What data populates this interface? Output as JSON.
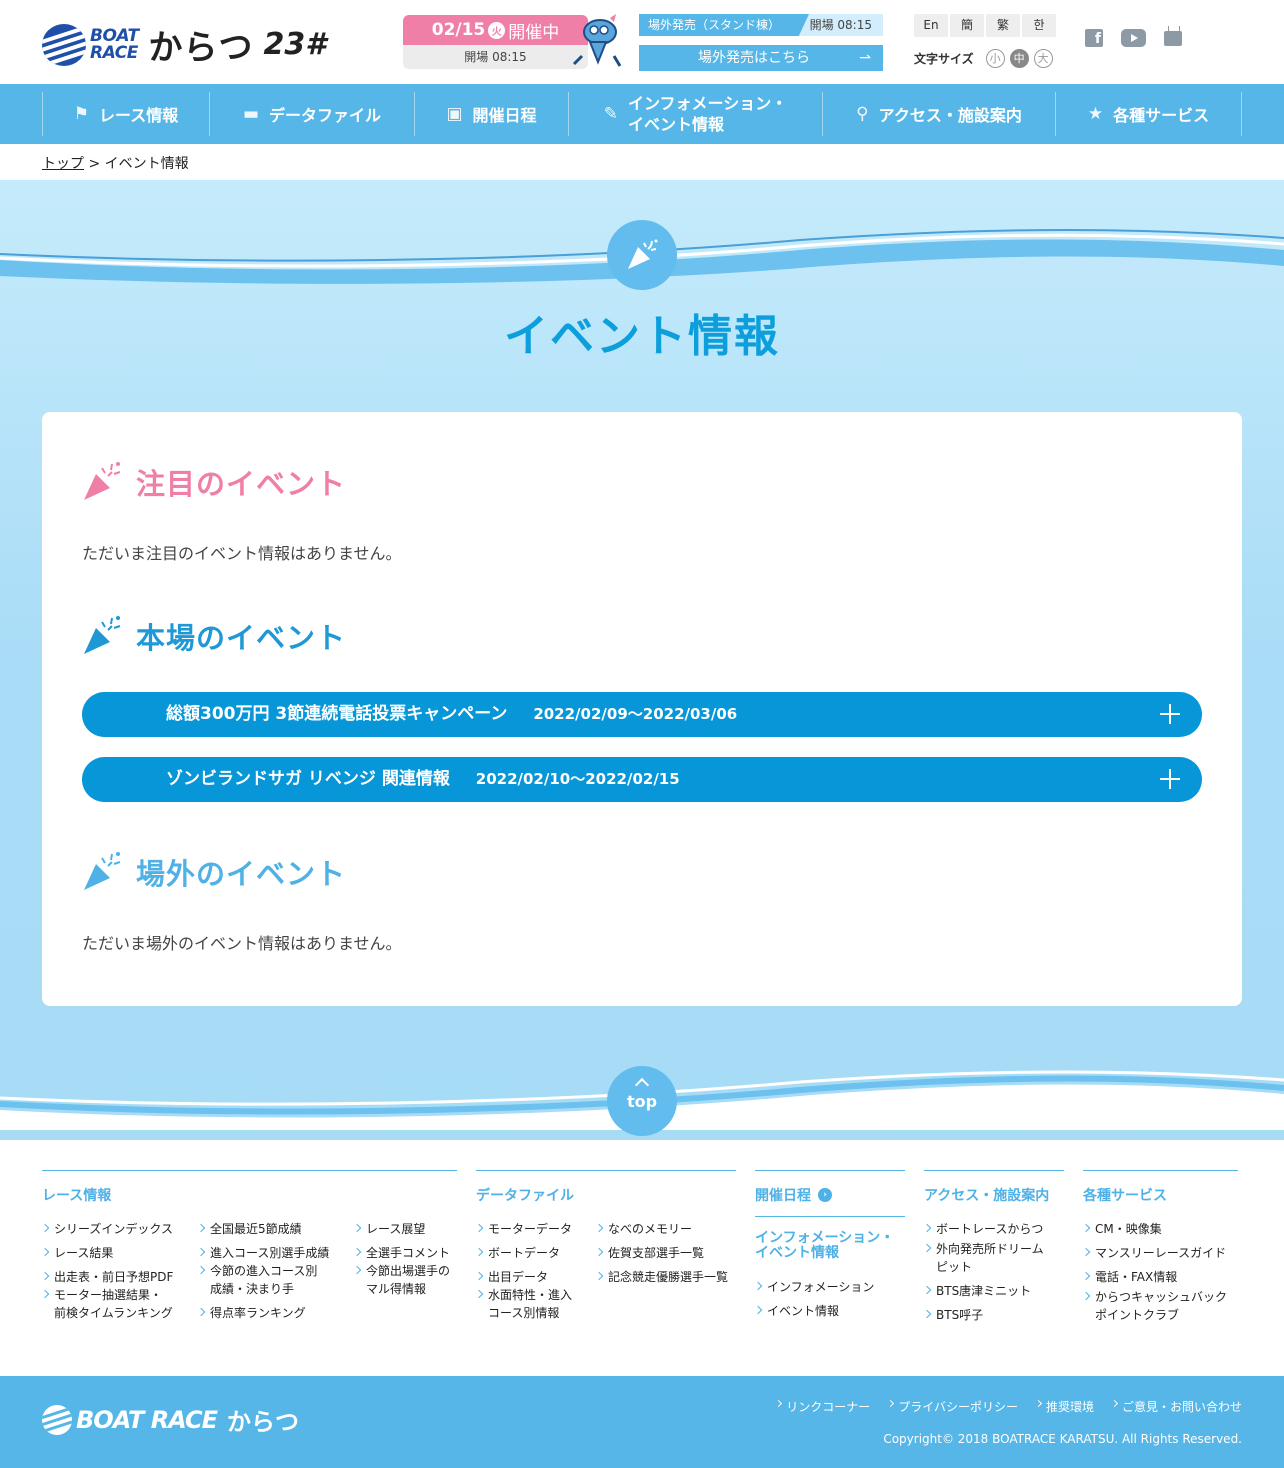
{
  "header": {
    "logo_en": "BOAT\nRACE",
    "logo_kanji": "からつ",
    "logo_num": "23#",
    "today": {
      "date": "02/15",
      "dow": "火",
      "status": "開催中",
      "open": "開場 08:15"
    },
    "offsite": {
      "label": "場外発売（スタンド棟）",
      "time": "開場 08:15",
      "button": "場外発売はこちら"
    },
    "languages": [
      "En",
      "簡",
      "繁",
      "한"
    ],
    "fontsize": {
      "label": "文字サイズ",
      "options": [
        "小",
        "中",
        "大"
      ],
      "selected": "中"
    }
  },
  "nav": [
    {
      "label": "レース情報",
      "icon": "flag-icon"
    },
    {
      "label": "データファイル",
      "icon": "folder-icon"
    },
    {
      "label": "開催日程",
      "icon": "calendar-icon"
    },
    {
      "label": "インフォメーション・\nイベント情報",
      "icon": "pencil-icon"
    },
    {
      "label": "アクセス・施設案内",
      "icon": "pin-icon"
    },
    {
      "label": "各種サービス",
      "icon": "star-icon"
    }
  ],
  "breadcrumb": {
    "home": "トップ",
    "sep": " > ",
    "current": "イベント情報"
  },
  "page_title": "イベント情報",
  "sections": {
    "featured": {
      "title": "注目のイベント",
      "text": "ただいま注目のイベント情報はありません。"
    },
    "local": {
      "title": "本場のイベント",
      "events": [
        {
          "title": "総額300万円 3節連続電話投票キャンペーン",
          "date": "2022/02/09～2022/03/06"
        },
        {
          "title": "ゾンビランドサガ リベンジ 関連情報",
          "date": "2022/02/10～2022/02/15"
        }
      ]
    },
    "offsite": {
      "title": "場外のイベント",
      "text": "ただいま場外のイベント情報はありません。"
    }
  },
  "top_button": "top",
  "sitemap": {
    "race": {
      "title": "レース情報",
      "col1": [
        "シリーズインデックス",
        "レース結果",
        "出走表・前日予想PDF",
        "モーター抽選結果・\n前検タイムランキング"
      ],
      "col2": [
        "全国最近5節成績",
        "進入コース別選手成績",
        "今節の進入コース別\n成績・決まり手",
        "得点率ランキング"
      ],
      "col3": [
        "レース展望",
        "全選手コメント",
        "今節出場選手の\nマル得情報"
      ]
    },
    "data": {
      "title": "データファイル",
      "col1": [
        "モーターデータ",
        "ボートデータ",
        "出目データ",
        "水面特性・進入\nコース別情報"
      ],
      "col2": [
        "なべのメモリー",
        "佐賀支部選手一覧",
        "記念競走優勝選手一覧"
      ]
    },
    "schedule": {
      "title": "開催日程"
    },
    "info": {
      "title": "インフォメーション・\nイベント情報",
      "links": [
        "インフォメーション",
        "イベント情報"
      ]
    },
    "access": {
      "title": "アクセス・施設案内",
      "links": [
        "ボートレースからつ",
        "外向発売所ドリーム\nピット",
        "BTS唐津ミニット",
        "BTS呼子"
      ]
    },
    "service": {
      "title": "各種サービス",
      "links": [
        "CM・映像集",
        "マンスリーレースガイド",
        "電話・FAX情報",
        "からつキャッシュバック\nポイントクラブ"
      ]
    }
  },
  "footer": {
    "logo_en": "BOAT RACE",
    "logo_kanji": "からつ",
    "links": [
      "リンクコーナー",
      "プライバシーポリシー",
      "推奨環境",
      "ご意見・お問い合わせ"
    ],
    "copyright": "Copyright© 2018 BOATRACE KARATSU. All Rights Reserved."
  }
}
